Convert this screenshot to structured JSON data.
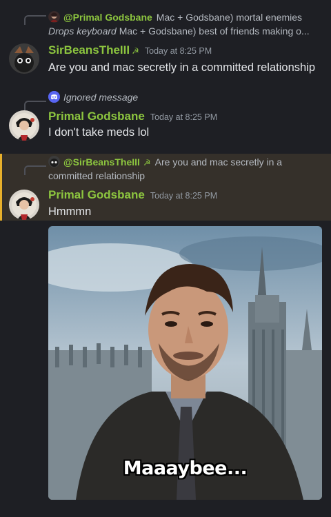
{
  "messages": [
    {
      "reply": {
        "name": "@Primal Godsbane",
        "text": "Mac + Godsbane) mortal enemies",
        "italic_line_em": "Drops keyboard",
        "italic_line_rest": " Mac + Godsbane) best of friends making o..."
      },
      "author": "SirBeansTheIII",
      "badge": "☭",
      "timestamp": "Today at 8:25 PM",
      "content": "Are you and mac secretly in a committed relationship"
    },
    {
      "reply": {
        "ignored": "Ignored message"
      },
      "author": "Primal Godsbane",
      "timestamp": "Today at 8:25 PM",
      "content": "I don't take meds lol"
    },
    {
      "reply": {
        "name": "@SirBeansTheIII",
        "badge": "☭",
        "text": "Are you and mac secretly in a committed relationship"
      },
      "author": "Primal Godsbane",
      "timestamp": "Today at 8:25 PM",
      "content": "Hmmmn",
      "gif_caption": "Maaaybee..."
    }
  ],
  "colors": {
    "background": "#1e1f24",
    "username": "#8dc63f",
    "highlight": "#35302a",
    "highlight_bar": "#e8b02b",
    "timestamp": "#949ba4"
  }
}
